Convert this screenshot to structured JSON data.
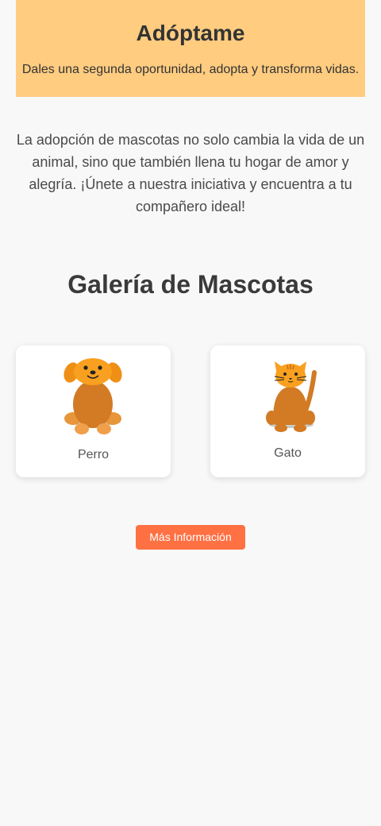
{
  "header": {
    "title": "Adóptame",
    "subtitle": "Dales una segunda oportunidad, adopta y transforma vidas."
  },
  "intro": {
    "text": "La adopción de mascotas no solo cambia la vida de un animal, sino que también llena tu hogar de amor y alegría. ¡Únete a nuestra iniciativa y encuentra a tu compañero ideal!"
  },
  "gallery": {
    "title": "Galería de Mascotas",
    "pets": [
      {
        "label": "Perro",
        "icon": "dog-icon"
      },
      {
        "label": "Gato",
        "icon": "cat-icon"
      }
    ]
  },
  "cta": {
    "label": "Más Información",
    "color": "#ff7043"
  },
  "colors": {
    "header_bg": "#ffcc80",
    "page_bg": "#f8f8f8",
    "pet_body": "#d27a24",
    "pet_head": "#f9a020"
  }
}
